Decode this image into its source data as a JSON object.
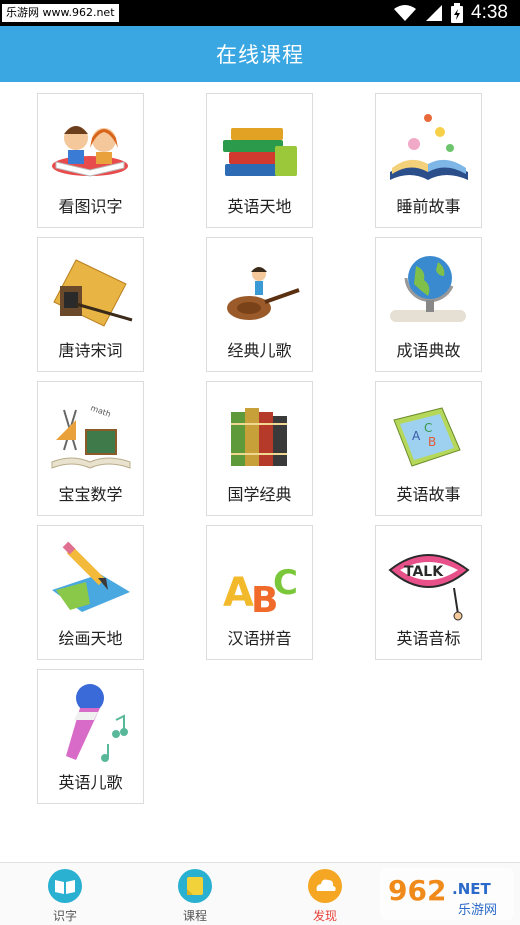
{
  "status_bar": {
    "watermark": "乐游网 www.962.net",
    "time": "4:38",
    "icons": [
      "wifi-icon",
      "signal-icon",
      "battery-icon"
    ]
  },
  "header": {
    "title": "在线课程",
    "color": "#3ba7e2"
  },
  "courses": [
    {
      "label": "看图识字",
      "icon": "kids-reading-icon"
    },
    {
      "label": "英语天地",
      "icon": "books-stack-icon"
    },
    {
      "label": "睡前故事",
      "icon": "storybook-icon"
    },
    {
      "label": "唐诗宋词",
      "icon": "scroll-brush-icon"
    },
    {
      "label": "经典儿歌",
      "icon": "violin-icon"
    },
    {
      "label": "成语典故",
      "icon": "globe-icon"
    },
    {
      "label": "宝宝数学",
      "icon": "math-tools-icon"
    },
    {
      "label": "国学经典",
      "icon": "classic-books-icon"
    },
    {
      "label": "英语故事",
      "icon": "abc-book-icon"
    },
    {
      "label": "绘画天地",
      "icon": "pencil-drawing-icon"
    },
    {
      "label": "汉语拼音",
      "icon": "abc-letters-icon"
    },
    {
      "label": "英语音标",
      "icon": "talk-lips-icon"
    },
    {
      "label": "英语儿歌",
      "icon": "microphone-icon"
    }
  ],
  "bottom_nav": [
    {
      "label": "识字",
      "icon": "book-icon",
      "active": false
    },
    {
      "label": "课程",
      "icon": "note-icon",
      "active": false
    },
    {
      "label": "发现",
      "icon": "cloud-icon",
      "active": true
    }
  ],
  "watermark_bottom": {
    "brand": "962",
    "suffix": ".NET",
    "caption": "乐游网"
  }
}
